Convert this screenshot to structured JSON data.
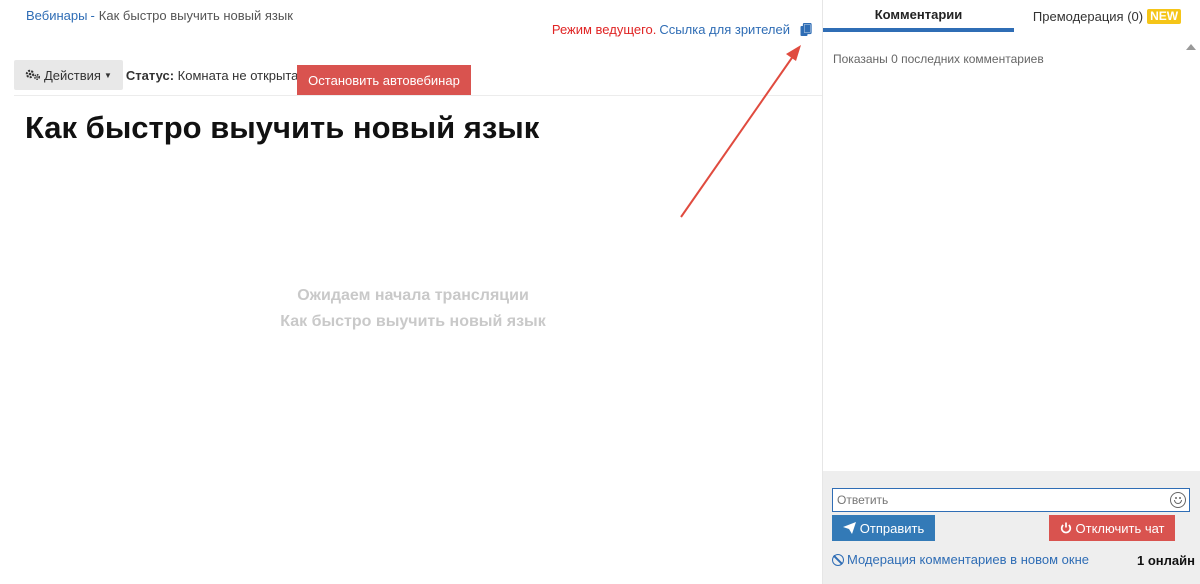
{
  "breadcrumb": {
    "root": "Вебинары",
    "separator": "-",
    "current": "Как быстро выучить новый язык"
  },
  "host": {
    "mode_text": "Режим ведущего.",
    "viewer_link": "Ссылка для зрителей",
    "copy_icon": "copy-icon"
  },
  "toolbar": {
    "actions_label": "Действия",
    "status_label": "Статус:",
    "status_value": "Комната не открыта",
    "stop_button": "Остановить автовебинар"
  },
  "main": {
    "title": "Как быстро выучить новый язык",
    "waiting_line1": "Ожидаем начала трансляции",
    "waiting_line2": "Как быстро выучить новый язык"
  },
  "sidebar": {
    "tabs": [
      {
        "label": "Комментарии",
        "active": true
      },
      {
        "label": "Премодерация (0)",
        "badge": "NEW"
      }
    ],
    "shown_text": "Показаны 0 последних комментариев",
    "reply_placeholder": "Ответить",
    "send_button": "Отправить",
    "disable_chat_button": "Отключить чат",
    "moderation_link": "Модерация комментариев в новом окне",
    "online_count": "1 онлайн"
  },
  "colors": {
    "link": "#2f6db5",
    "danger": "#d9534f",
    "primary": "#337ab7",
    "badge": "#f5c518",
    "mode": "#e02424"
  }
}
